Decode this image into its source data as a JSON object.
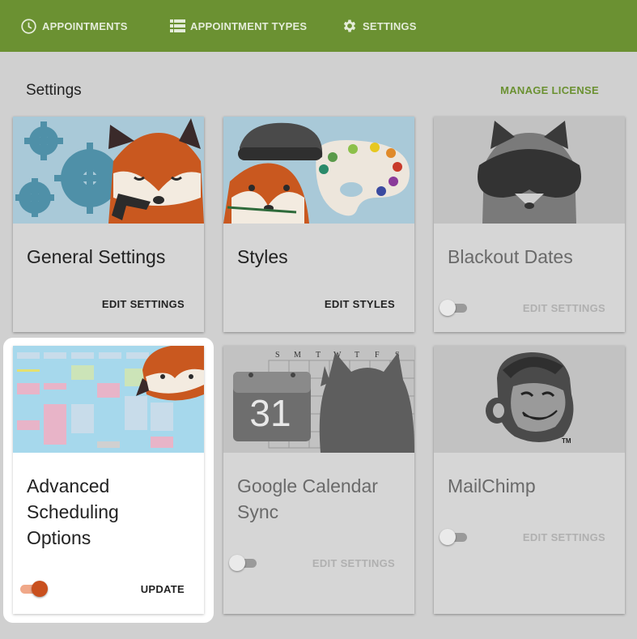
{
  "nav": {
    "appointments": "APPOINTMENTS",
    "appointment_types": "APPOINTMENT TYPES",
    "settings": "SETTINGS"
  },
  "page": {
    "title": "Settings",
    "manage_license": "MANAGE LICENSE"
  },
  "cards": {
    "general": {
      "title": "General Settings",
      "action": "EDIT SETTINGS"
    },
    "styles": {
      "title": "Styles",
      "action": "EDIT STYLES"
    },
    "blackout": {
      "title": "Blackout Dates",
      "action": "EDIT SETTINGS",
      "enabled": false
    },
    "advanced": {
      "title_line1": "Advanced",
      "title_line2": "Scheduling",
      "title_line3": "Options",
      "action": "UPDATE",
      "enabled": true
    },
    "gcal": {
      "title_line1": "Google Calendar",
      "title_line2": "Sync",
      "action": "EDIT SETTINGS",
      "enabled": false,
      "calendar_day": "31",
      "weekdays": [
        "S",
        "M",
        "T",
        "W",
        "T",
        "F",
        "S"
      ]
    },
    "mailchimp": {
      "title": "MailChimp",
      "action": "EDIT SETTINGS",
      "enabled": false,
      "tm": "TM"
    }
  },
  "colors": {
    "nav_bg": "#6b9132",
    "accent_green": "#6b9132",
    "toggle_on": "#c9501e",
    "fox_orange": "#c9581f"
  },
  "icons": {
    "appointments": "clock-icon",
    "appointment_types": "list-icon",
    "settings": "gear-icon"
  }
}
